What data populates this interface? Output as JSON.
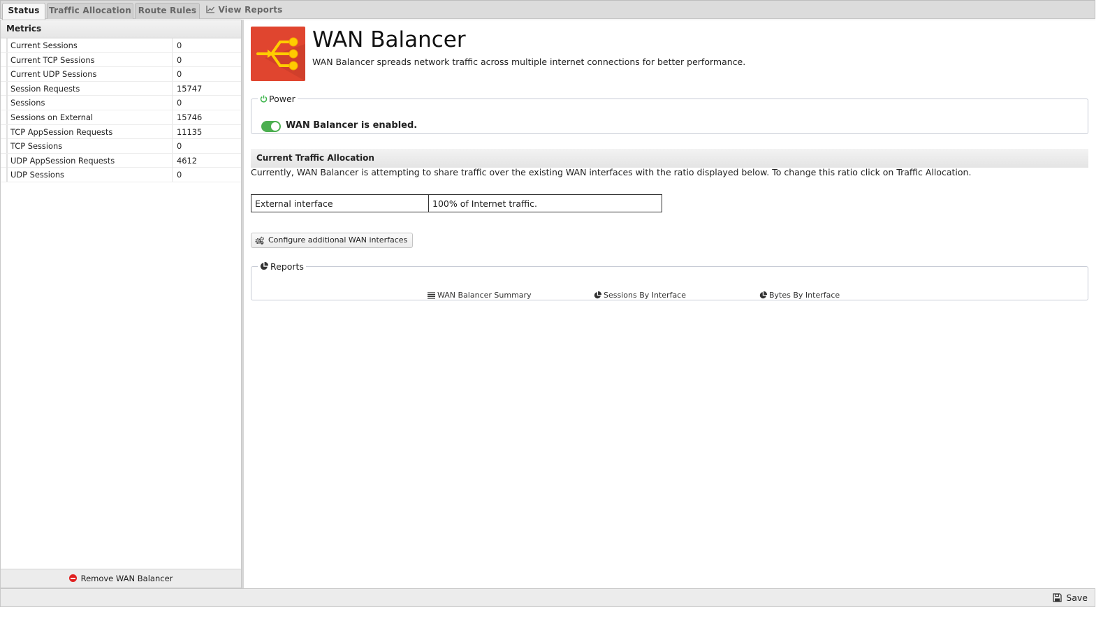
{
  "tabs": [
    {
      "label": "Status"
    },
    {
      "label": "Traffic Allocation"
    },
    {
      "label": "Route Rules"
    },
    {
      "label": "View Reports"
    }
  ],
  "metrics": {
    "title": "Metrics",
    "rows": [
      {
        "name": "Current Sessions",
        "value": "0"
      },
      {
        "name": "Current TCP Sessions",
        "value": "0"
      },
      {
        "name": "Current UDP Sessions",
        "value": "0"
      },
      {
        "name": "Session Requests",
        "value": "15747"
      },
      {
        "name": "Sessions",
        "value": "0"
      },
      {
        "name": "Sessions on External",
        "value": "15746"
      },
      {
        "name": "TCP AppSession Requests",
        "value": "11135"
      },
      {
        "name": "TCP Sessions",
        "value": "0"
      },
      {
        "name": "UDP AppSession Requests",
        "value": "4612"
      },
      {
        "name": "UDP Sessions",
        "value": "0"
      }
    ],
    "remove_label": "Remove WAN Balancer"
  },
  "app": {
    "title": "WAN Balancer",
    "description": "WAN Balancer spreads network traffic across multiple internet connections for better performance."
  },
  "power": {
    "legend": "Power",
    "status": "WAN Balancer is enabled.",
    "enabled": true
  },
  "allocation": {
    "heading": "Current Traffic Allocation",
    "text": "Currently, WAN Balancer is attempting to share traffic over the existing WAN interfaces with the ratio displayed below. To change this ratio click on Traffic Allocation.",
    "rows": [
      {
        "interface": "External interface",
        "share": "100% of Internet traffic."
      }
    ],
    "configure_label": "Configure additional WAN interfaces"
  },
  "reports": {
    "legend": "Reports",
    "links": [
      {
        "label": "WAN Balancer Summary",
        "icon": "list-icon"
      },
      {
        "label": "Sessions By Interface",
        "icon": "pie-icon"
      },
      {
        "label": "Bytes By Interface",
        "icon": "pie-icon"
      }
    ]
  },
  "footer": {
    "save_label": "Save"
  },
  "colors": {
    "accent": "#e0452f",
    "toggle_on": "#4caf50",
    "remove": "#e02020"
  }
}
